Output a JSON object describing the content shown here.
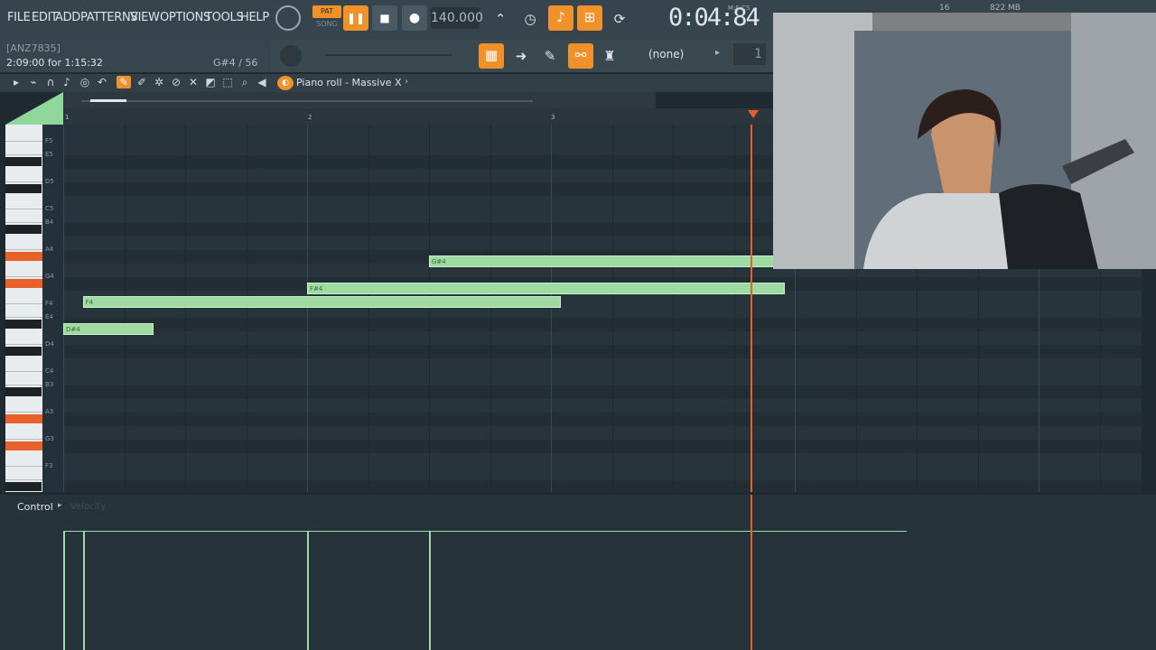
{
  "menu": [
    "FILE",
    "EDIT",
    "ADD",
    "PATTERNS",
    "VIEW",
    "OPTIONS",
    "TOOLS",
    "HELP"
  ],
  "transport": {
    "pat_label": "PAT",
    "song_label": "SONG",
    "tempo": "140.000",
    "time": "0:04:84",
    "time_unit": "M:S:CS",
    "cpu": "16",
    "memory": "822 MB"
  },
  "hint": {
    "line1": "[ANZ7835]",
    "line2": "2:09:00 for 1:15:32",
    "note_info": "G#4 / 56"
  },
  "toolbar2": {
    "pattern_select": "(none)",
    "pattern_number": "1"
  },
  "piano_roll": {
    "title": "Piano roll - Massive X",
    "bar_numbers": [
      "1",
      "2",
      "3"
    ],
    "key_labels": [
      "F5",
      "E5",
      "D5",
      "C5",
      "B4",
      "A4",
      "G4",
      "F4",
      "E4",
      "D4",
      "C4",
      "B3",
      "A3",
      "G3",
      "F3"
    ],
    "notes": [
      {
        "label": "G#4",
        "pitch": "G#4",
        "start_bar": 2.5,
        "length_bars": 1.96
      },
      {
        "label": "F#4",
        "pitch": "F#4",
        "start_bar": 2.0,
        "length_bars": 1.96
      },
      {
        "label": "F4",
        "pitch": "F4",
        "start_bar": 1.08,
        "length_bars": 1.96
      },
      {
        "label": "D#4",
        "pitch": "D#4",
        "start_bar": 1.0,
        "length_bars": 0.37
      }
    ],
    "playhead_bar": 3.82
  },
  "control": {
    "label": "Control",
    "param": "Velocity"
  },
  "colors": {
    "accent": "#f0912a",
    "note": "#9ddba3",
    "playhead": "#e8612a",
    "background": "#27333a"
  }
}
